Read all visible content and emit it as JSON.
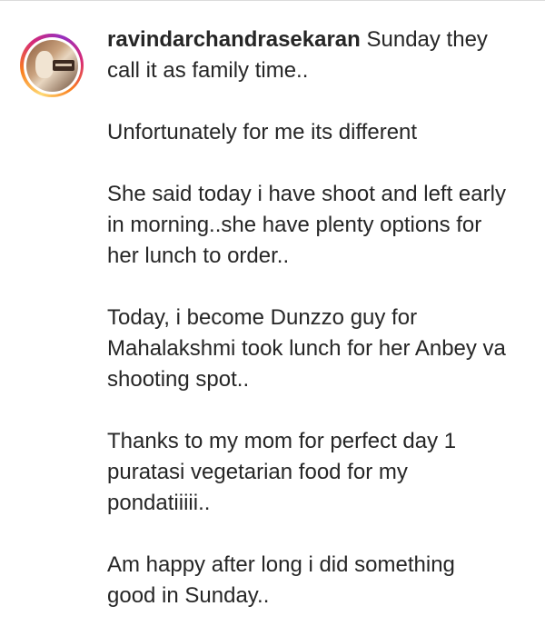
{
  "caption": {
    "username": "ravindarchandrasekaran",
    "paragraphs": [
      "Sunday they call it as family time..",
      "Unfortunately for me its different",
      "She said today i have shoot and left early in morning..she have plenty options for her lunch to order..",
      "Today, i become Dunzzo guy for Mahalakshmi took lunch for her Anbey va shooting spot..",
      "Thanks to my mom for perfect day 1 puratasi vegetarian food for my pondatiiiii..",
      "Am happy after long i did something good in Sunday.."
    ]
  },
  "avatar": {
    "icon": "profile-picture-with-story-ring",
    "ring_colors": [
      "#feda75",
      "#fa7e1e",
      "#d62976",
      "#962fbf"
    ]
  }
}
